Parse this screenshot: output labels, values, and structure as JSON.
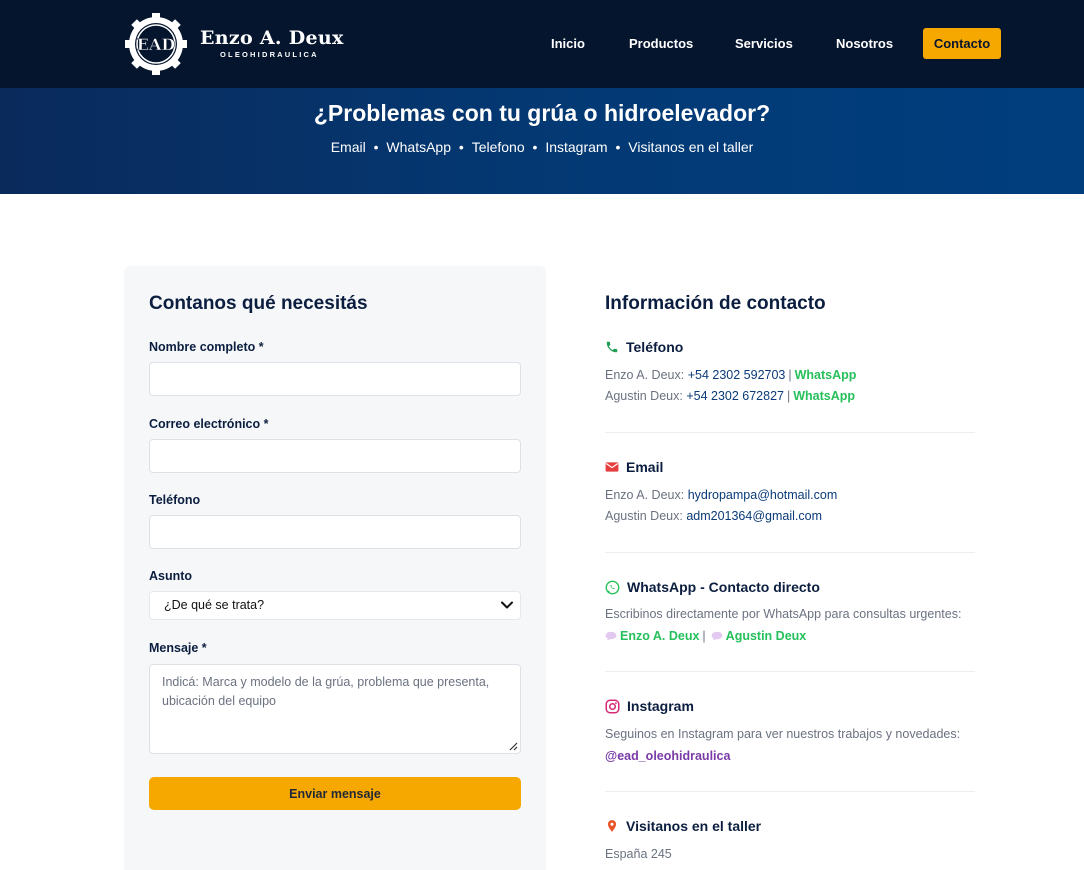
{
  "nav": {
    "logo_text": "EAD",
    "brand_name": "Enzo A. Deux",
    "brand_sub": "OLEOHIDRAULICA",
    "links": [
      "Inicio",
      "Productos",
      "Servicios",
      "Nosotros"
    ],
    "cta": "Contacto",
    "cta_color": "#f7a800"
  },
  "hero": {
    "title": "¿Problemas con tu grúa o hidroelevador?",
    "channels": [
      "Email",
      "WhatsApp",
      "Telefono",
      "Instagram",
      "Visitanos en el taller"
    ],
    "separator": "•"
  },
  "form": {
    "title": "Contanos qué necesitás",
    "name_label": "Nombre completo *",
    "name_value": "",
    "email_label": "Correo electrónico *",
    "email_value": "",
    "phone_label": "Teléfono",
    "phone_value": "",
    "subject_label": "Asunto",
    "subject_selected": "¿De qué se trata?",
    "message_label": "Mensaje *",
    "message_placeholder": "Indicá: Marca y modelo de la grúa, problema que presenta, ubicación del equipo",
    "submit": "Enviar mensaje"
  },
  "info": {
    "title": "Información de contacto",
    "phone": {
      "heading": "Teléfono",
      "icon": "phone-icon",
      "rows": [
        {
          "name": "Enzo A. Deux:",
          "number": "+54 2302 592703",
          "wa": "WhatsApp"
        },
        {
          "name": "Agustin Deux:",
          "number": "+54 2302 672827",
          "wa": "WhatsApp"
        }
      ]
    },
    "email": {
      "heading": "Email",
      "icon": "mail-icon",
      "rows": [
        {
          "name": "Enzo A. Deux:",
          "address": "hydropampa@hotmail.com"
        },
        {
          "name": "Agustin Deux:",
          "address": "adm201364@gmail.com"
        }
      ]
    },
    "whatsapp": {
      "heading": "WhatsApp - Contacto directo",
      "icon": "whatsapp-icon",
      "text": "Escribinos directamente por WhatsApp para consultas urgentes:",
      "contacts": [
        "Enzo A. Deux",
        "Agustin Deux"
      ]
    },
    "instagram": {
      "heading": "Instagram",
      "icon": "instagram-icon",
      "text": "Seguinos en Instagram para ver nuestros trabajos y novedades:",
      "handle": "@ead_oleohidraulica"
    },
    "taller": {
      "heading": "Visitanos en el taller",
      "icon": "location-pin-icon",
      "address": "España 245"
    }
  }
}
